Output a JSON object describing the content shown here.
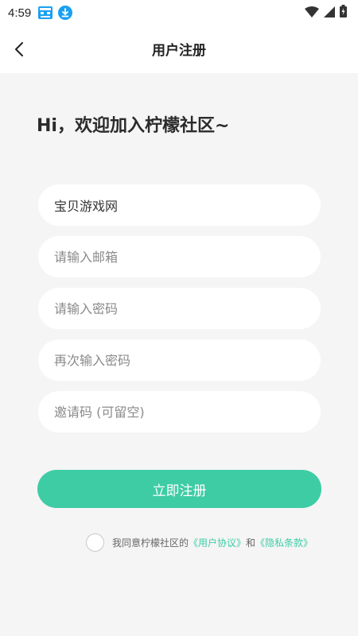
{
  "status_bar": {
    "time": "4:59",
    "icons": [
      "app-notification-icon",
      "download-icon",
      "wifi-icon",
      "signal-icon",
      "battery-icon"
    ]
  },
  "nav": {
    "title": "用户注册",
    "back_icon": "chevron-left-icon"
  },
  "greeting": "Hi，欢迎加入柠檬社区~",
  "form": {
    "username_value": "宝贝游戏网",
    "email_placeholder": "请输入邮箱",
    "password_placeholder": "请输入密码",
    "confirm_password_placeholder": "再次输入密码",
    "invite_code_placeholder": "邀请码 (可留空)"
  },
  "submit_label": "立即注册",
  "agreement": {
    "prefix": "我同意柠檬社区的",
    "user_agreement": "《用户协议》",
    "and": "和",
    "privacy_policy": "《隐私条款》"
  },
  "colors": {
    "accent": "#3ecca5",
    "background": "#f5f5f5",
    "download_badge": "#1aa0f0"
  }
}
